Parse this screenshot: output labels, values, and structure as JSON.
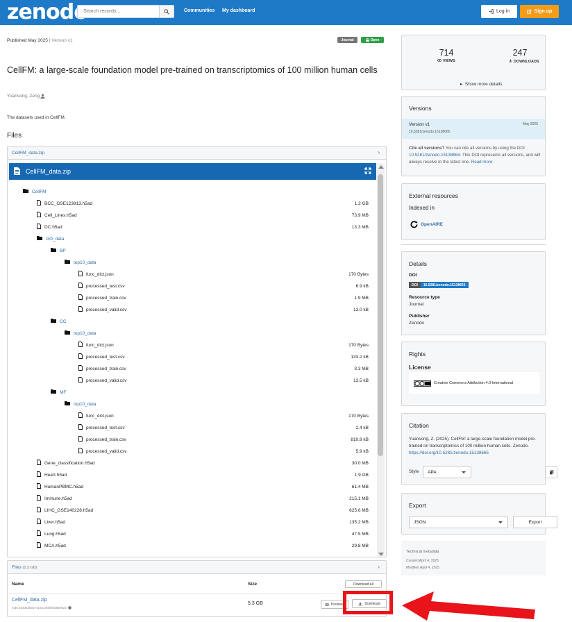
{
  "header": {
    "logo": "zenodo",
    "search_placeholder": "Search records...",
    "nav": [
      "Communities",
      "My dashboard"
    ],
    "login_label": "Log in",
    "signup_label": "Sign up"
  },
  "record": {
    "published": "Published May 2025",
    "sep": "|",
    "version": "Version v1",
    "badge_type": "Journal",
    "badge_open": "Open",
    "title": "CellFM: a large-scale foundation model pre-trained on transcriptomics of 100 million human cells",
    "author": "Yuansong, Zeng",
    "description": "The datasets used in CellFM.",
    "files_heading": "Files"
  },
  "preview": {
    "header_label": "CellFM_data.zip",
    "frame_title": "CellFM_data.zip",
    "tree": [
      {
        "name": "CellFM",
        "type": "folder",
        "depth": 0,
        "size": ""
      },
      {
        "name": "BCC_GSE123813.h5ad",
        "type": "file",
        "depth": 1,
        "size": "1.2 GB"
      },
      {
        "name": "Cell_Lines.h5ad",
        "type": "file",
        "depth": 1,
        "size": "73.9 MB"
      },
      {
        "name": "DC.h5ad",
        "type": "file",
        "depth": 1,
        "size": "13.3 MB"
      },
      {
        "name": "GO_data",
        "type": "folder",
        "depth": 1,
        "size": ""
      },
      {
        "name": "BP",
        "type": "folder",
        "depth": 2,
        "size": ""
      },
      {
        "name": "top10_data",
        "type": "folder",
        "depth": 3,
        "size": ""
      },
      {
        "name": "func_dict.json",
        "type": "file",
        "depth": 4,
        "size": "170 Bytes"
      },
      {
        "name": "processed_test.csv",
        "type": "file",
        "depth": 4,
        "size": "6.9 kB"
      },
      {
        "name": "processed_train.csv",
        "type": "file",
        "depth": 4,
        "size": "1.9 MB"
      },
      {
        "name": "processed_valid.csv",
        "type": "file",
        "depth": 4,
        "size": "13.0 kB"
      },
      {
        "name": "CC",
        "type": "folder",
        "depth": 2,
        "size": ""
      },
      {
        "name": "top10_data",
        "type": "folder",
        "depth": 3,
        "size": ""
      },
      {
        "name": "func_dict.json",
        "type": "file",
        "depth": 4,
        "size": "170 Bytes"
      },
      {
        "name": "processed_test.csv",
        "type": "file",
        "depth": 4,
        "size": "133.2 kB"
      },
      {
        "name": "processed_train.csv",
        "type": "file",
        "depth": 4,
        "size": "3.3 MB"
      },
      {
        "name": "processed_valid.csv",
        "type": "file",
        "depth": 4,
        "size": "13.5 kB"
      },
      {
        "name": "MF",
        "type": "folder",
        "depth": 2,
        "size": ""
      },
      {
        "name": "top10_data",
        "type": "folder",
        "depth": 3,
        "size": ""
      },
      {
        "name": "func_dict.json",
        "type": "file",
        "depth": 4,
        "size": "170 Bytes"
      },
      {
        "name": "processed_test.csv",
        "type": "file",
        "depth": 4,
        "size": "2.4 kB"
      },
      {
        "name": "processed_train.csv",
        "type": "file",
        "depth": 4,
        "size": "810.9 kB"
      },
      {
        "name": "processed_valid.csv",
        "type": "file",
        "depth": 4,
        "size": "5.9 kB"
      },
      {
        "name": "Gene_classification.h5ad",
        "type": "file",
        "depth": 1,
        "size": "30.0 MB"
      },
      {
        "name": "Heart.h5ad",
        "type": "file",
        "depth": 1,
        "size": "1.9 GB"
      },
      {
        "name": "HumanPBMC.h5ad",
        "type": "file",
        "depth": 1,
        "size": "61.4 MB"
      },
      {
        "name": "Immune.h5ad",
        "type": "file",
        "depth": 1,
        "size": "215.1 MB"
      },
      {
        "name": "LIHC_GSE140228.h5ad",
        "type": "file",
        "depth": 1,
        "size": "625.6 MB"
      },
      {
        "name": "Liver.h5ad",
        "type": "file",
        "depth": 1,
        "size": "135.2 MB"
      },
      {
        "name": "Lung.h5ad",
        "type": "file",
        "depth": 1,
        "size": "47.5 MB"
      },
      {
        "name": "MCA.h5ad",
        "type": "file",
        "depth": 1,
        "size": "29.8 MB"
      }
    ]
  },
  "files_table": {
    "header_label": "Files",
    "count": "(5.3 GB)",
    "col_name": "Name",
    "col_size": "Size",
    "download_all": "Download all",
    "file_name": "CellFM_data.zip",
    "md5": "md5:4d4d63b917419227bd6fc5883923",
    "file_size": "5.3 GB",
    "preview_label": "Preview",
    "download_label": "Download"
  },
  "stats": {
    "views": "714",
    "views_label": "VIEWS",
    "downloads": "247",
    "downloads_label": "DOWNLOADS",
    "show_more": "Show more details"
  },
  "versions": {
    "heading": "Versions",
    "current": "Version v1",
    "current_date": "May 2025",
    "current_doi": "10.5281/zenodo.15138665",
    "cite_bold": "Cite all versions?",
    "cite_text": " You can cite all versions by using the DOI ",
    "cite_doi": "10.5281/zenodo.15138664",
    "cite_text2": ". This DOI represents all versions, and will always resolve to the latest one. ",
    "read_more": "Read more."
  },
  "external": {
    "heading": "External resources",
    "indexed": "Indexed in",
    "openaire": "OpenAIRE"
  },
  "details": {
    "heading": "Details",
    "doi_label": "DOI",
    "doi_key": "DOI",
    "doi_value": "10.5281/zenodo.15138665",
    "rt_label": "Resource type",
    "rt_value": "Journal",
    "pub_label": "Publisher",
    "pub_value": "Zenodo"
  },
  "rights": {
    "heading": "Rights",
    "license": "License",
    "cc_text": "Creative Commons Attribution 4.0 International"
  },
  "citation": {
    "heading": "Citation",
    "text": "Yuansong, Z. (2025). CellFM: a large-scale foundation model pre-trained on transcriptomics of 100 million human cells. Zenodo.",
    "link": "https://doi.org/10.5281/zenodo.15138665",
    "style_label": "Style",
    "style_value": "APA"
  },
  "export": {
    "heading": "Export",
    "format": "JSON",
    "button": "Export"
  },
  "technical": {
    "heading": "Technical metadata",
    "created": "Created April 4, 2025",
    "modified": "Modified April 4, 2025"
  },
  "colors": {
    "header_blue": "#1e7ac6",
    "signup_orange": "#f39c1a",
    "link_blue": "#2e6ca4",
    "highlight_red": "#e8141a"
  }
}
